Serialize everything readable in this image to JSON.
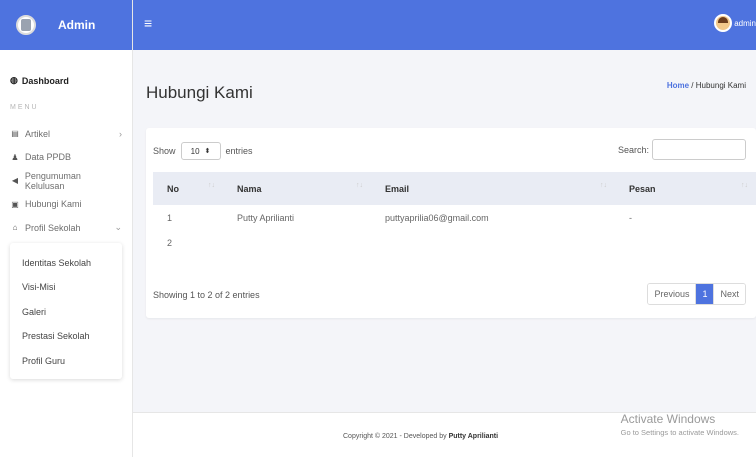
{
  "brand": {
    "title": "Admin"
  },
  "sidebar": {
    "dashboard": "Dashboard",
    "section": "MENU",
    "items": [
      {
        "label": "Artikel",
        "icon": "newspaper-icon",
        "has_chevron": true
      },
      {
        "label": "Data PPDB",
        "icon": "user-icon"
      },
      {
        "label": "Pengumuman Kelulusan",
        "icon": "megaphone-icon"
      },
      {
        "label": "Hubungi Kami",
        "icon": "contact-card-icon"
      },
      {
        "label": "Profil Sekolah",
        "icon": "school-icon",
        "has_chevron": true
      }
    ],
    "submenu": [
      "Identitas Sekolah",
      "Visi-Misi",
      "Galeri",
      "Prestasi Sekolah",
      "Profil Guru"
    ]
  },
  "topbar": {
    "username": "admin"
  },
  "page": {
    "title": "Hubungi Kami",
    "breadcrumb_home": "Home",
    "breadcrumb_sep": "/",
    "breadcrumb_current": "Hubungi Kami"
  },
  "table": {
    "show_label": "Show",
    "entries_value": "10",
    "entries_label": "entries",
    "search_label": "Search:",
    "columns": [
      "No",
      "Nama",
      "Email",
      "Pesan"
    ],
    "rows": [
      [
        "1",
        "Putty Aprilianti",
        "puttyaprilia06@gmail.com",
        "-"
      ],
      [
        "2",
        "",
        "",
        ""
      ]
    ],
    "info": "Showing 1 to 2 of 2 entries",
    "pager": {
      "prev": "Previous",
      "current": "1",
      "next": "Next"
    }
  },
  "footer": {
    "copyright": "Copyright © 2021 - Developed by",
    "author": "Putty Aprilianti"
  },
  "watermark": {
    "title": "Activate Windows",
    "subtitle": "Go to Settings to activate Windows."
  },
  "colors": {
    "primary": "#4e73df"
  }
}
